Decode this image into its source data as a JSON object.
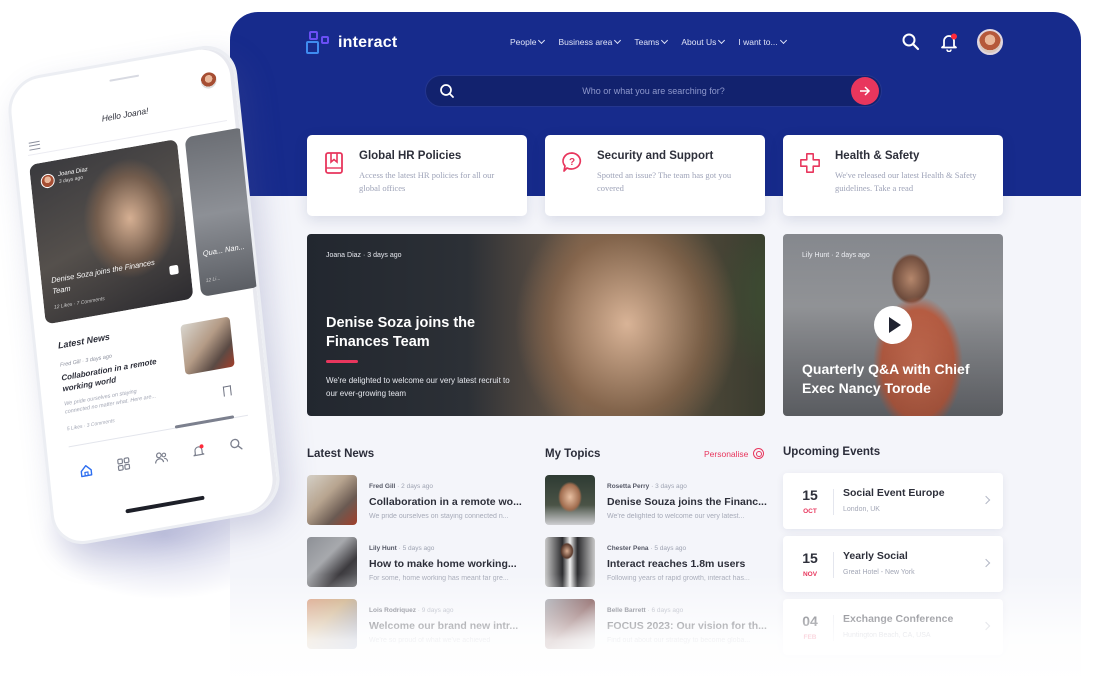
{
  "app": {
    "brand": "interact",
    "colors": {
      "primary": "#172b8c",
      "accent": "#e8365d",
      "background": "#f4f5fa"
    }
  },
  "nav": {
    "items": [
      {
        "label": "People"
      },
      {
        "label": "Business area"
      },
      {
        "label": "Teams"
      },
      {
        "label": "About Us"
      },
      {
        "label": "I want to..."
      }
    ],
    "icons": [
      "search-icon",
      "bell-icon",
      "avatar"
    ],
    "notification_dot": true
  },
  "search": {
    "placeholder": "Who or what you are searching for?",
    "value": ""
  },
  "quick_links": [
    {
      "icon": "bookmark-book-icon",
      "title": "Global HR Policies",
      "description": "Access the latest HR policies for all our global offices"
    },
    {
      "icon": "question-bubble-icon",
      "title": "Security and Support",
      "description": "Spotted an issue? The team has got you covered"
    },
    {
      "icon": "medical-cross-icon",
      "title": "Health & Safety",
      "description": "We've released our latest Health & Safety guidelines. Take a read"
    }
  ],
  "hero": {
    "author": "Joana Diaz",
    "time": "3 days ago",
    "title": "Denise Soza joins the Finances Team",
    "description": "We're delighted to welcome our very latest recruit to our ever-growing team"
  },
  "video": {
    "author": "Lily Hunt",
    "time": "2 days ago",
    "title": "Quarterly Q&A with Chief Exec Nancy Torode"
  },
  "latest_news": {
    "title": "Latest News",
    "items": [
      {
        "author": "Fred Gill",
        "time": "2 days ago",
        "title": "Collaboration in a remote wo...",
        "snippet": "We pride ourselves on staying connected n..."
      },
      {
        "author": "Lily Hunt",
        "time": "5 days ago",
        "title": "How to make home working...",
        "snippet": "For some, home working has meant far gre..."
      },
      {
        "author": "Lois Rodriquez",
        "time": "9 days ago",
        "title": "Welcome our brand new intr...",
        "snippet": "We're so proud of what we've achieved"
      }
    ]
  },
  "my_topics": {
    "title": "My Topics",
    "personalise_label": "Personalise",
    "items": [
      {
        "author": "Rosetta Perry",
        "time": "3 days ago",
        "title": "Denise Souza joins the Financ...",
        "snippet": "We're delighted to welcome our very latest..."
      },
      {
        "author": "Chester Pena",
        "time": "5 days ago",
        "title": "Interact reaches 1.8m users",
        "snippet": "Following years of rapid growth, interact has..."
      },
      {
        "author": "Belle Barrett",
        "time": "6 days ago",
        "title": "FOCUS 2023: Our vision for th...",
        "snippet": "Find out about our strategy to become globa..."
      }
    ]
  },
  "events": {
    "title": "Upcoming Events",
    "items": [
      {
        "day": "15",
        "month": "OCT",
        "title": "Social Event Europe",
        "location": "London, UK"
      },
      {
        "day": "15",
        "month": "NOV",
        "title": "Yearly Social",
        "location": "Great Hotel - New York"
      },
      {
        "day": "04",
        "month": "FEB",
        "title": "Exchange Conference",
        "location": "Huntington Beach, CA, USA"
      }
    ]
  },
  "phone": {
    "greeting": "Hello Joana!",
    "feature_card": {
      "author": "Joana Diaz",
      "time": "3 days ago",
      "title": "Denise Soza joins the Finances Team",
      "stats": "12 Likes · 7 Comments"
    },
    "second_card": {
      "title": "Qua... Nan...",
      "stats": "12 Li..."
    },
    "section_title": "Latest News",
    "news": {
      "author": "Fred Gill",
      "time": "3 days ago",
      "title": "Collaboration in a remote working world",
      "snippet": "We pride ourselves on staying connected no matter what. Here are...",
      "stats": "5 Likes · 3 Comments"
    },
    "tabs": [
      "home-icon",
      "grid-icon",
      "people-icon",
      "bell-icon",
      "search-icon"
    ],
    "active_tab": "home-icon"
  }
}
